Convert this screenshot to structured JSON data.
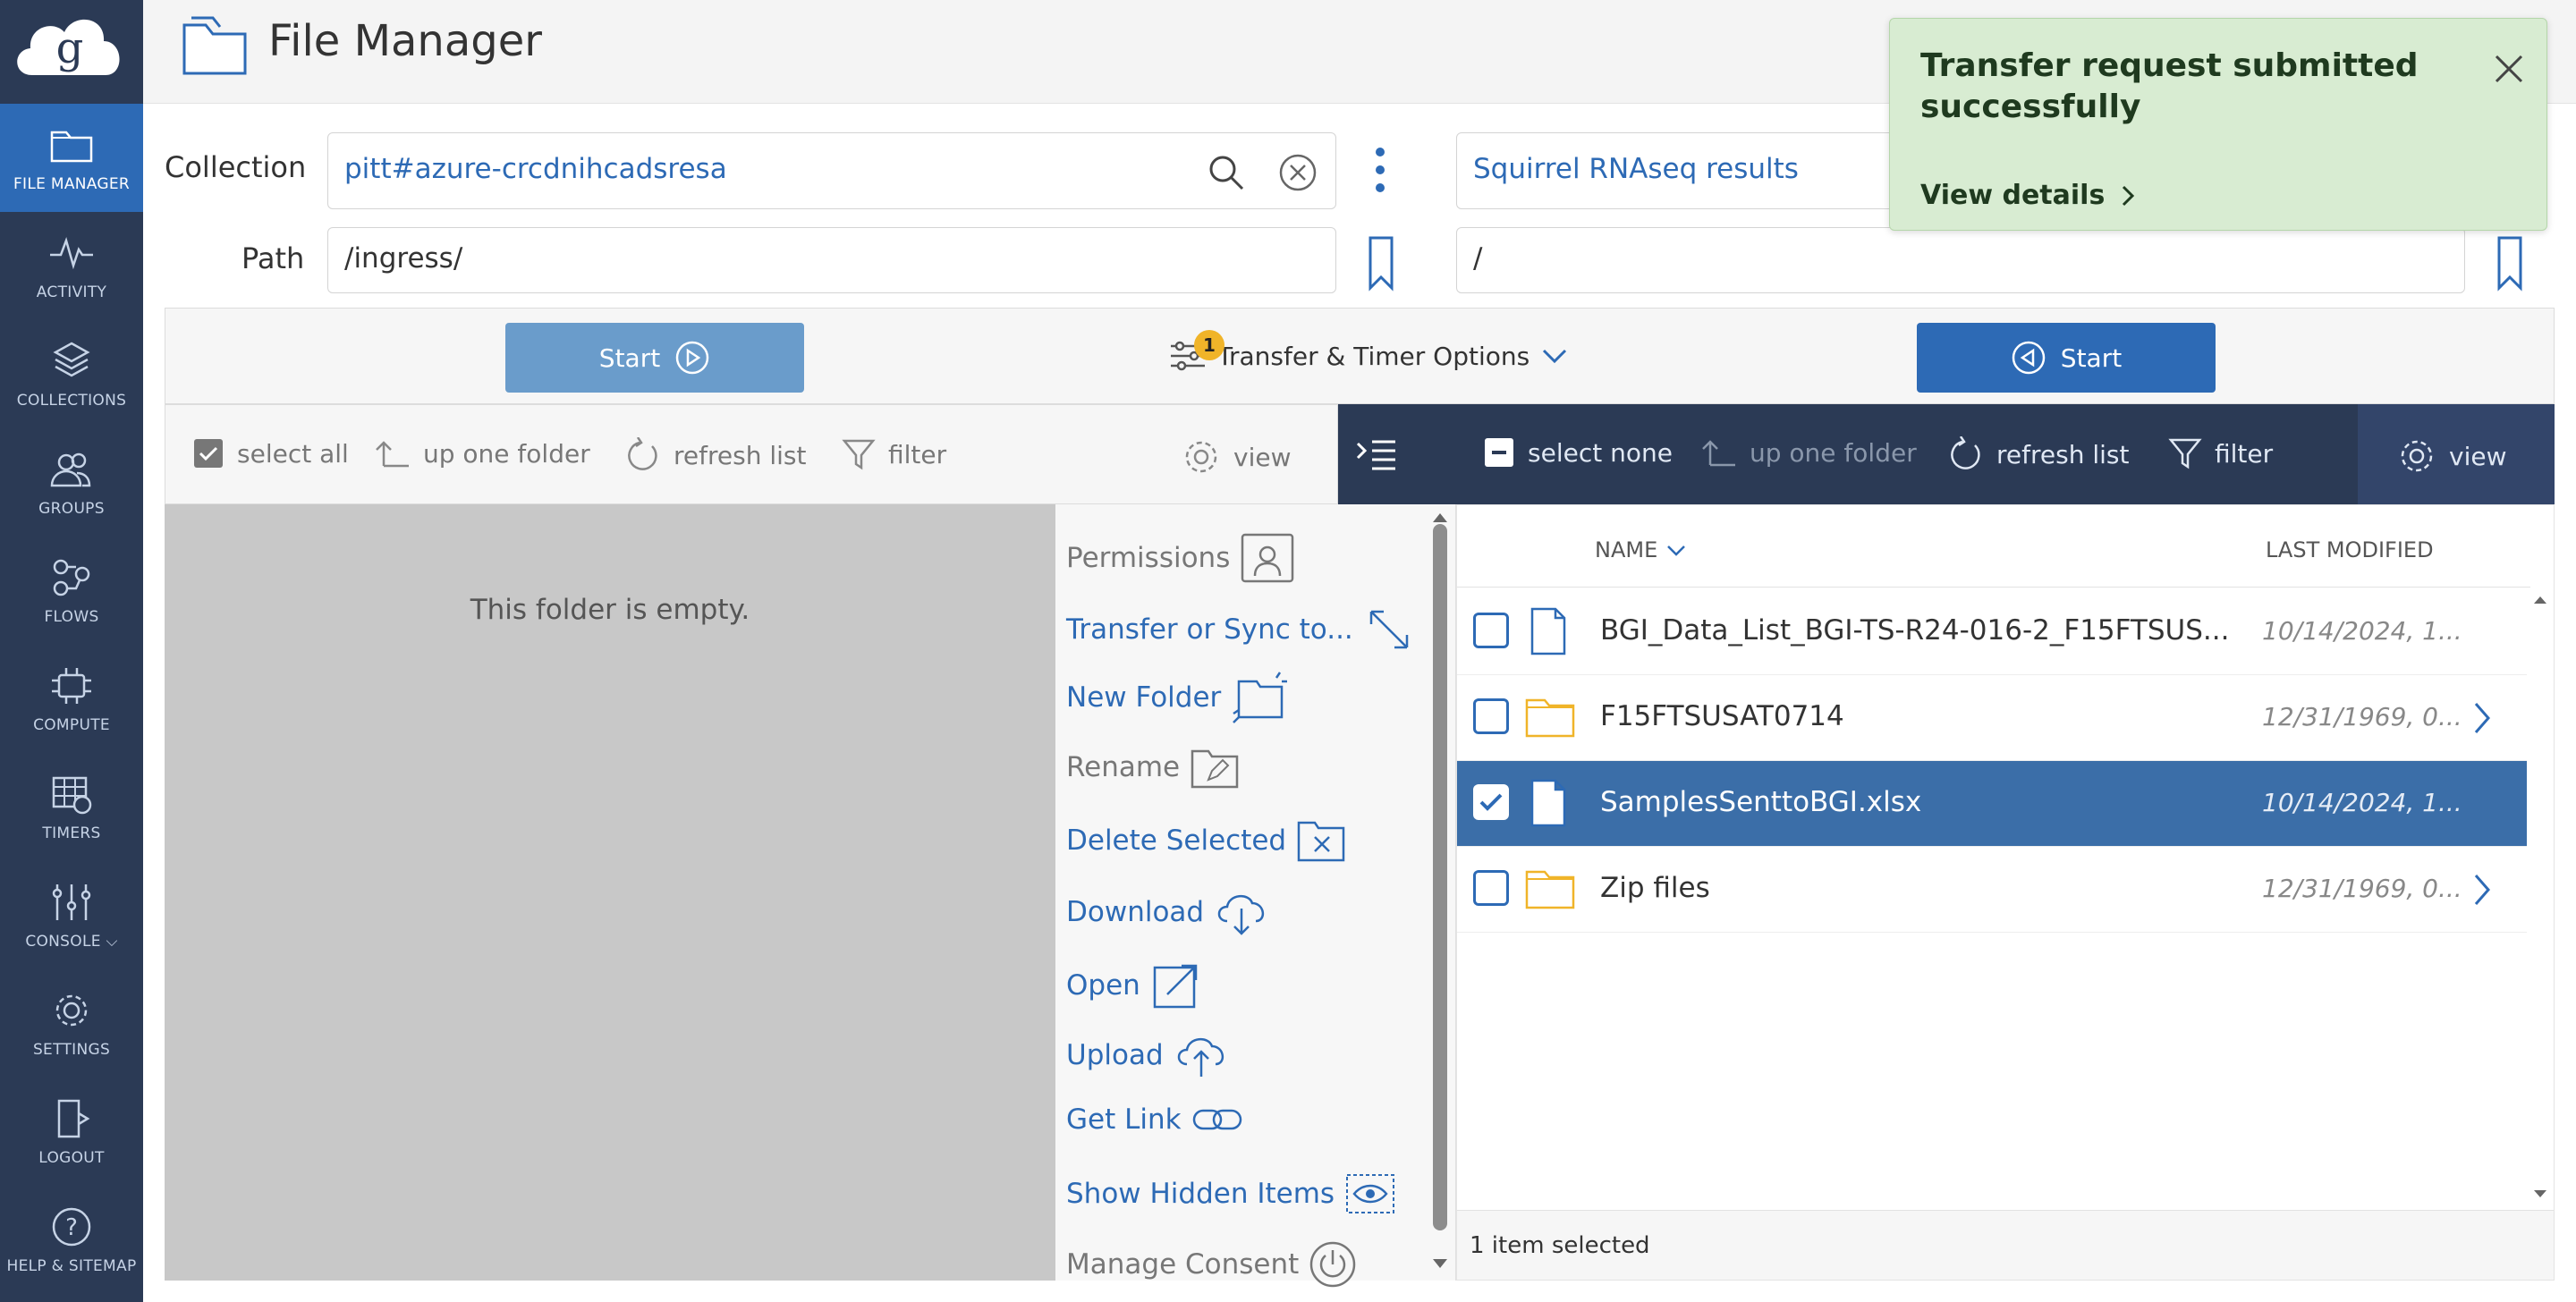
{
  "app": {
    "title": "File Manager"
  },
  "sidebar": {
    "items": [
      {
        "label": "FILE MANAGER",
        "icon": "folder-icon",
        "active": true
      },
      {
        "label": "ACTIVITY",
        "icon": "activity-icon"
      },
      {
        "label": "COLLECTIONS",
        "icon": "layers-icon"
      },
      {
        "label": "GROUPS",
        "icon": "groups-icon"
      },
      {
        "label": "FLOWS",
        "icon": "flows-icon"
      },
      {
        "label": "COMPUTE",
        "icon": "compute-icon"
      },
      {
        "label": "TIMERS",
        "icon": "timers-icon"
      },
      {
        "label": "CONSOLE",
        "icon": "console-icon"
      },
      {
        "label": "SETTINGS",
        "icon": "gear-icon"
      },
      {
        "label": "LOGOUT",
        "icon": "logout-icon"
      },
      {
        "label": "HELP & SITEMAP",
        "icon": "help-icon"
      }
    ]
  },
  "left": {
    "collection_label": "Collection",
    "collection_value": "pitt#azure-crcdnihcadsresa",
    "path_label": "Path",
    "path_value": "/ingress/",
    "start_label": "Start",
    "toolbar": {
      "select": "select all",
      "up": "up one folder",
      "refresh": "refresh list",
      "filter": "filter",
      "view": "view"
    },
    "empty_text": "This folder is empty."
  },
  "right": {
    "collection_value": "Squirrel RNAseq results",
    "path_value": "/",
    "start_label": "Start",
    "toolbar": {
      "select": "select none",
      "up": "up one folder",
      "refresh": "refresh list",
      "filter": "filter",
      "view": "view"
    },
    "columns": {
      "name": "NAME",
      "modified": "LAST MODIFIED"
    },
    "rows": [
      {
        "name": "BGI_Data_List_BGI-TS-R24-016-2_F15FTSUS...",
        "modified": "10/14/2024, 1...",
        "type": "file",
        "selected": false
      },
      {
        "name": "F15FTSUSAT0714",
        "modified": "12/31/1969, 0...",
        "type": "folder",
        "selected": false
      },
      {
        "name": "SamplesSenttoBGI.xlsx",
        "modified": "10/14/2024, 1...",
        "type": "file",
        "selected": true
      },
      {
        "name": "Zip files",
        "modified": "12/31/1969, 0...",
        "type": "folder",
        "selected": false
      }
    ],
    "status": "1 item selected"
  },
  "options": {
    "label": "Transfer & Timer Options",
    "badge": "1"
  },
  "actions": [
    {
      "label": "Permissions",
      "enabled": false
    },
    {
      "label": "Transfer or Sync to...",
      "enabled": true
    },
    {
      "label": "New Folder",
      "enabled": true
    },
    {
      "label": "Rename",
      "enabled": false
    },
    {
      "label": "Delete Selected",
      "enabled": true
    },
    {
      "label": "Download",
      "enabled": true
    },
    {
      "label": "Open",
      "enabled": true
    },
    {
      "label": "Upload",
      "enabled": true
    },
    {
      "label": "Get Link",
      "enabled": true
    },
    {
      "label": "Show Hidden Items",
      "enabled": true
    },
    {
      "label": "Manage Consent",
      "enabled": false
    }
  ],
  "toast": {
    "title": "Transfer request submitted successfully",
    "link": "View details"
  },
  "colors": {
    "sidebar": "#2b3a55",
    "active": "#2d6ab5",
    "accent": "#2d6ab5",
    "selected_row": "#3b6ea8",
    "toast_bg": "#d8ecd2",
    "badge": "#f0b429"
  }
}
